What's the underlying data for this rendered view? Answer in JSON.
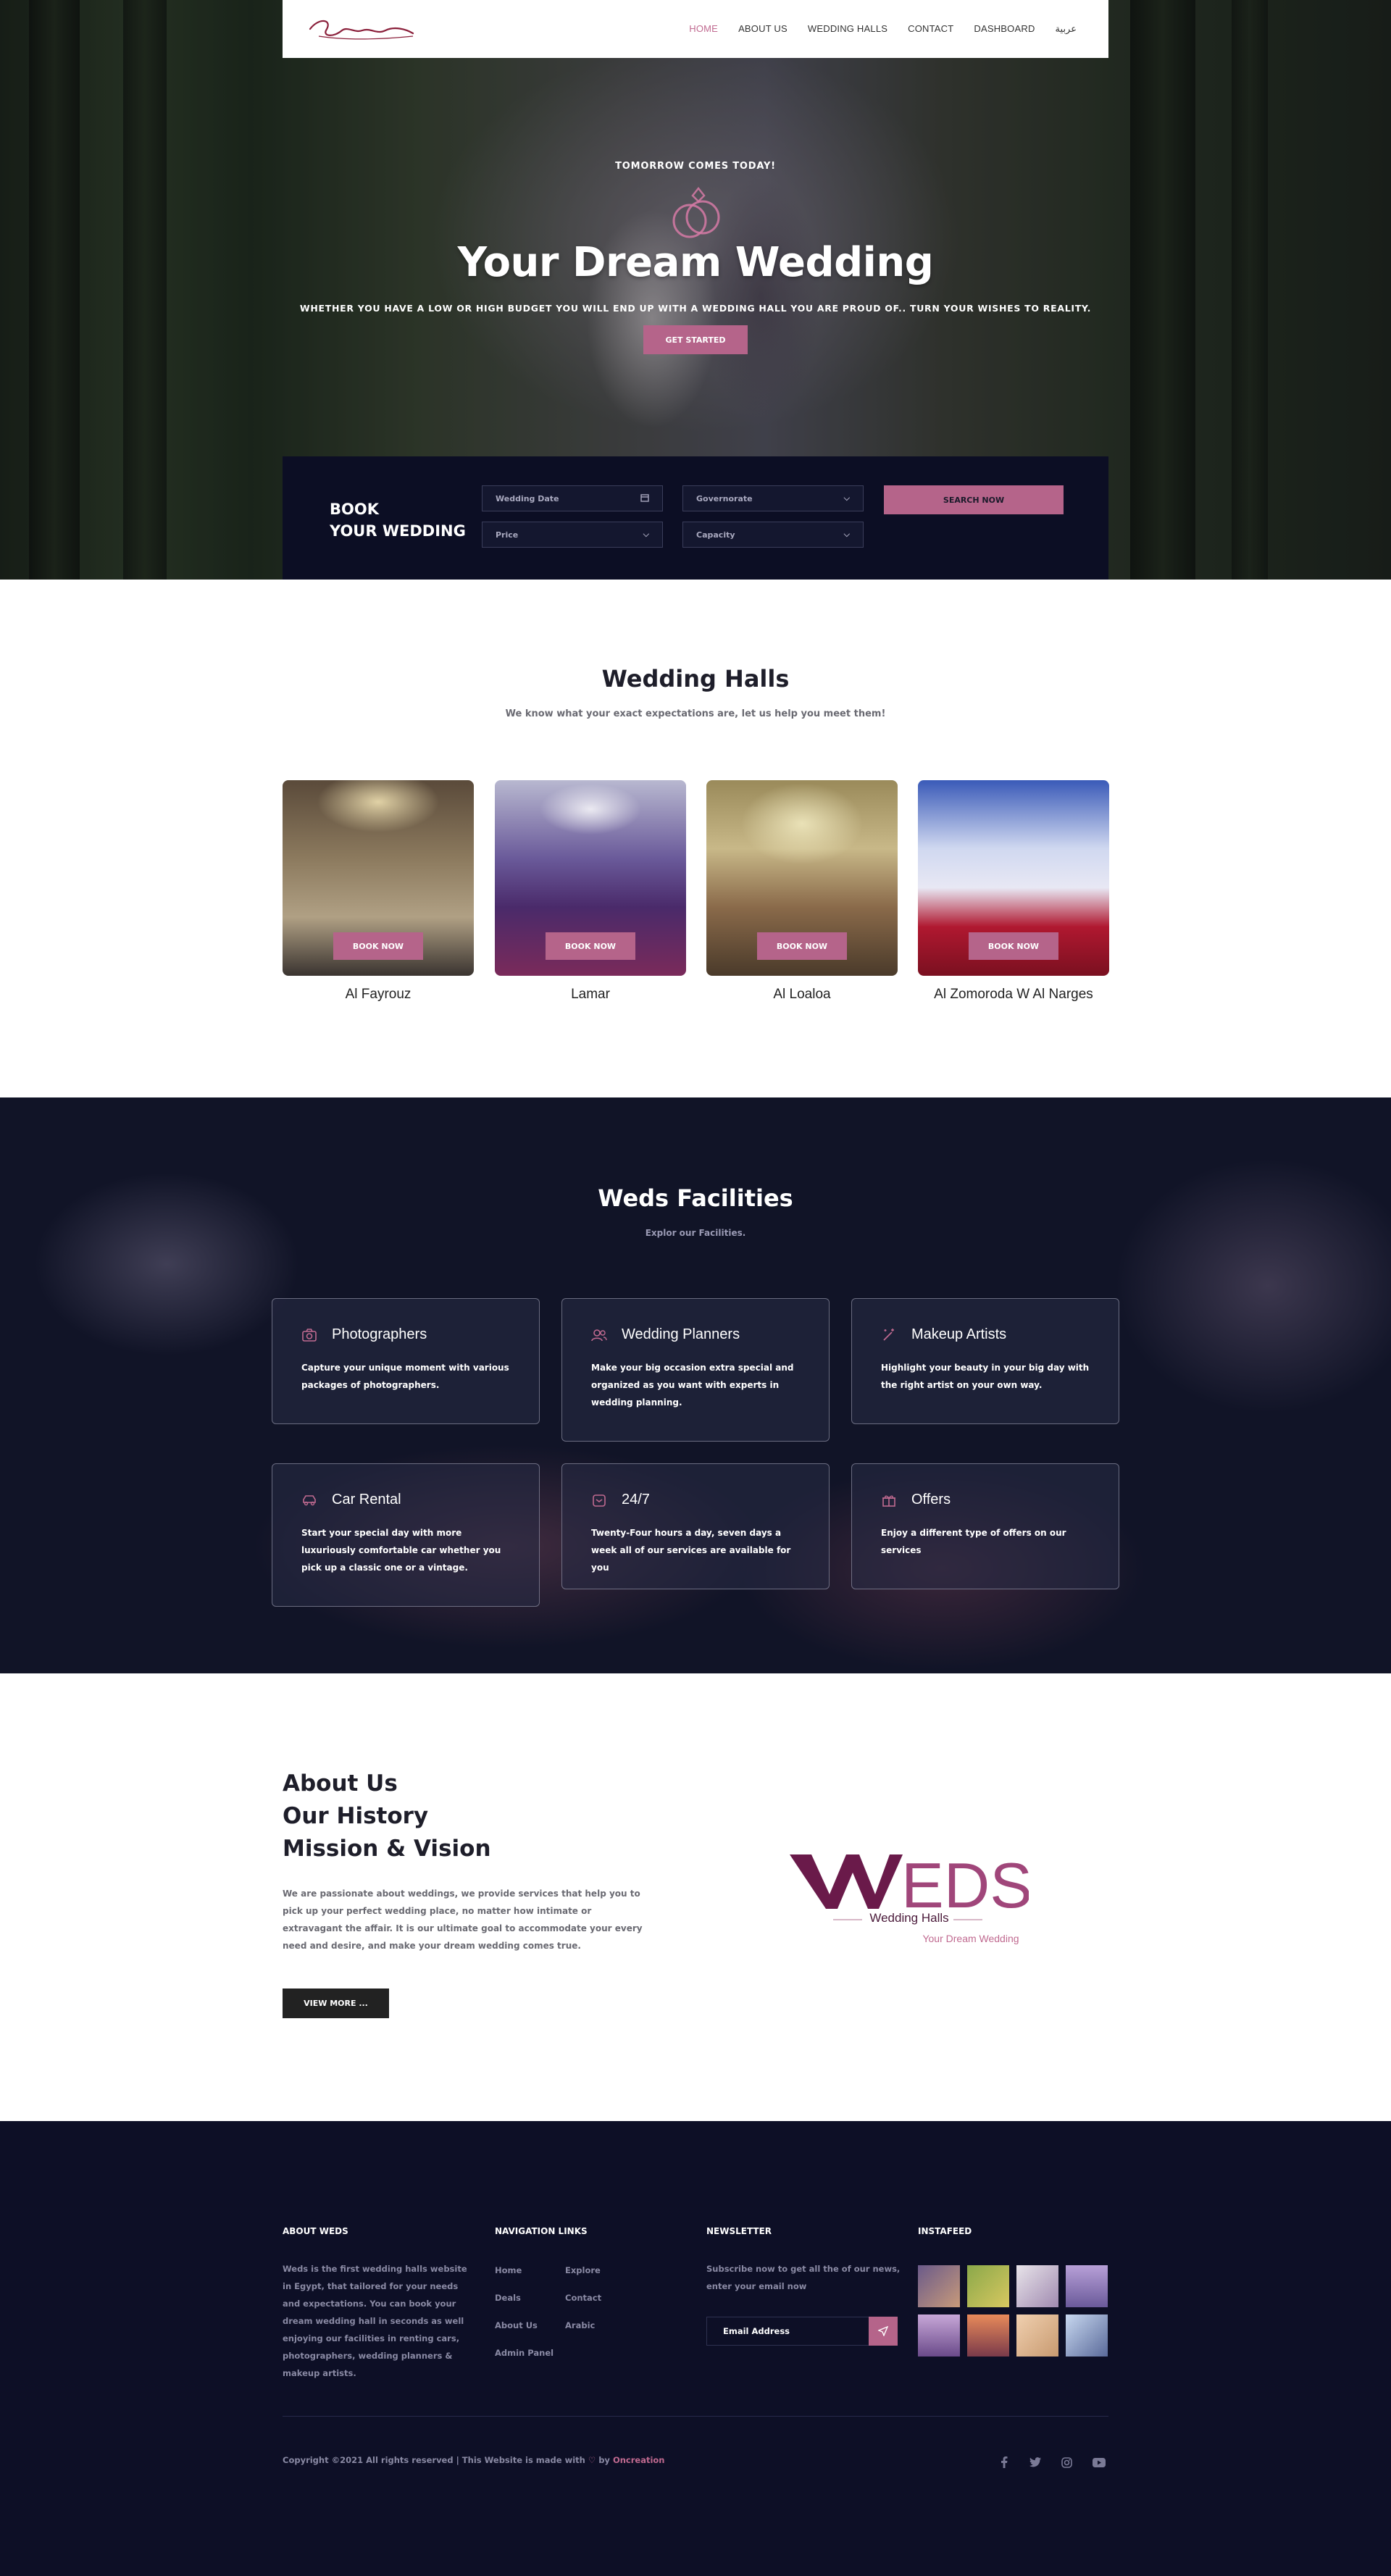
{
  "brand_color": "#b5648a",
  "dark_color": "#0c0e24",
  "nav": {
    "logo_text": "Weds",
    "links": [
      "HOME",
      "ABOUT US",
      "WEDDING HALLS",
      "CONTACT",
      "DASHBOARD",
      "عربية"
    ],
    "active_index": 0
  },
  "hero": {
    "kicker": "TOMORROW COMES TODAY!",
    "title": "Your Dream Wedding",
    "subtitle": "WHETHER YOU HAVE A LOW OR HIGH BUDGET YOU WILL END UP WITH A WEDDING HALL YOU ARE PROUD OF.. TURN YOUR WISHES TO REALITY.",
    "cta": "GET STARTED"
  },
  "booking": {
    "title_line1": "BOOK",
    "title_line2": "YOUR WEDDING",
    "wedding_date_placeholder": "Wedding Date",
    "governorate_label": "Governorate",
    "price_label": "Price",
    "capacity_label": "Capacity",
    "search_label": "SEARCH NOW"
  },
  "halls_section": {
    "title": "Wedding Halls",
    "subtitle": "We know what your exact expectations are, let us help you meet them!",
    "book_label": "BOOK NOW",
    "halls": [
      {
        "name": "Al Fayrouz"
      },
      {
        "name": "Lamar"
      },
      {
        "name": "Al Loaloa"
      },
      {
        "name": "Al Zomoroda W Al Narges"
      }
    ]
  },
  "facilities": {
    "title": "Weds Facilities",
    "subtitle": "Explor our Facilities.",
    "items": [
      {
        "icon": "camera-icon",
        "title": "Photographers",
        "text": "Capture your unique moment with various packages of photographers."
      },
      {
        "icon": "users-icon",
        "title": "Wedding Planners",
        "text": "Make your big occasion extra special and organized as you want with experts in wedding planning."
      },
      {
        "icon": "magic-wand-icon",
        "title": "Makeup Artists",
        "text": "Highlight your beauty in your big day with the right artist on your own way."
      },
      {
        "icon": "car-icon",
        "title": "Car Rental",
        "text": "Start your special day with more luxuriously comfortable car whether you pick up a classic one or a vintage."
      },
      {
        "icon": "clock-24-icon",
        "title": "24/7",
        "text": "Twenty-Four hours a day, seven days a week all of our services are available for you"
      },
      {
        "icon": "gift-icon",
        "title": "Offers",
        "text": "Enjoy a different type of offers on our services"
      }
    ]
  },
  "about": {
    "heading_line1": "About Us",
    "heading_line2": "Our History",
    "heading_line3": "Mission & Vision",
    "text": "We are passionate about weddings, we provide services that help you to pick up your perfect wedding place, no matter how intimate or extravagant the affair. It is our ultimate goal to accommodate your every need and desire, and make your dream wedding comes true.",
    "button": "VIEW MORE ...",
    "logo_main": "WEDS",
    "logo_sub": "Wedding Halls",
    "logo_tagline": "Your Dream Wedding"
  },
  "footer": {
    "about_title": "ABOUT WEDS",
    "about_text": "Weds is the first wedding halls website in Egypt, that tailored for your needs and expectations. You can book your dream wedding hall in seconds as well enjoying our facilities in renting cars, photographers, wedding planners & makeup artists.",
    "nav_title": "NAVIGATION LINKS",
    "nav_col1": [
      "Home",
      "Deals",
      "About Us",
      "Admin Panel"
    ],
    "nav_col2": [
      "Explore",
      "Contact",
      "Arabic"
    ],
    "newsletter_title": "NEWSLETTER",
    "newsletter_text": "Subscribe now to get all the of our news, enter your email now",
    "email_placeholder": "Email Address",
    "insta_title": "INSTAFEED",
    "copyright_prefix": "Copyright ©2021 All rights reserved | This Website is made with",
    "copyright_by": "by",
    "copyright_brand": "Oncreation",
    "social": [
      "facebook-icon",
      "twitter-icon",
      "instagram-icon",
      "youtube-icon"
    ]
  }
}
